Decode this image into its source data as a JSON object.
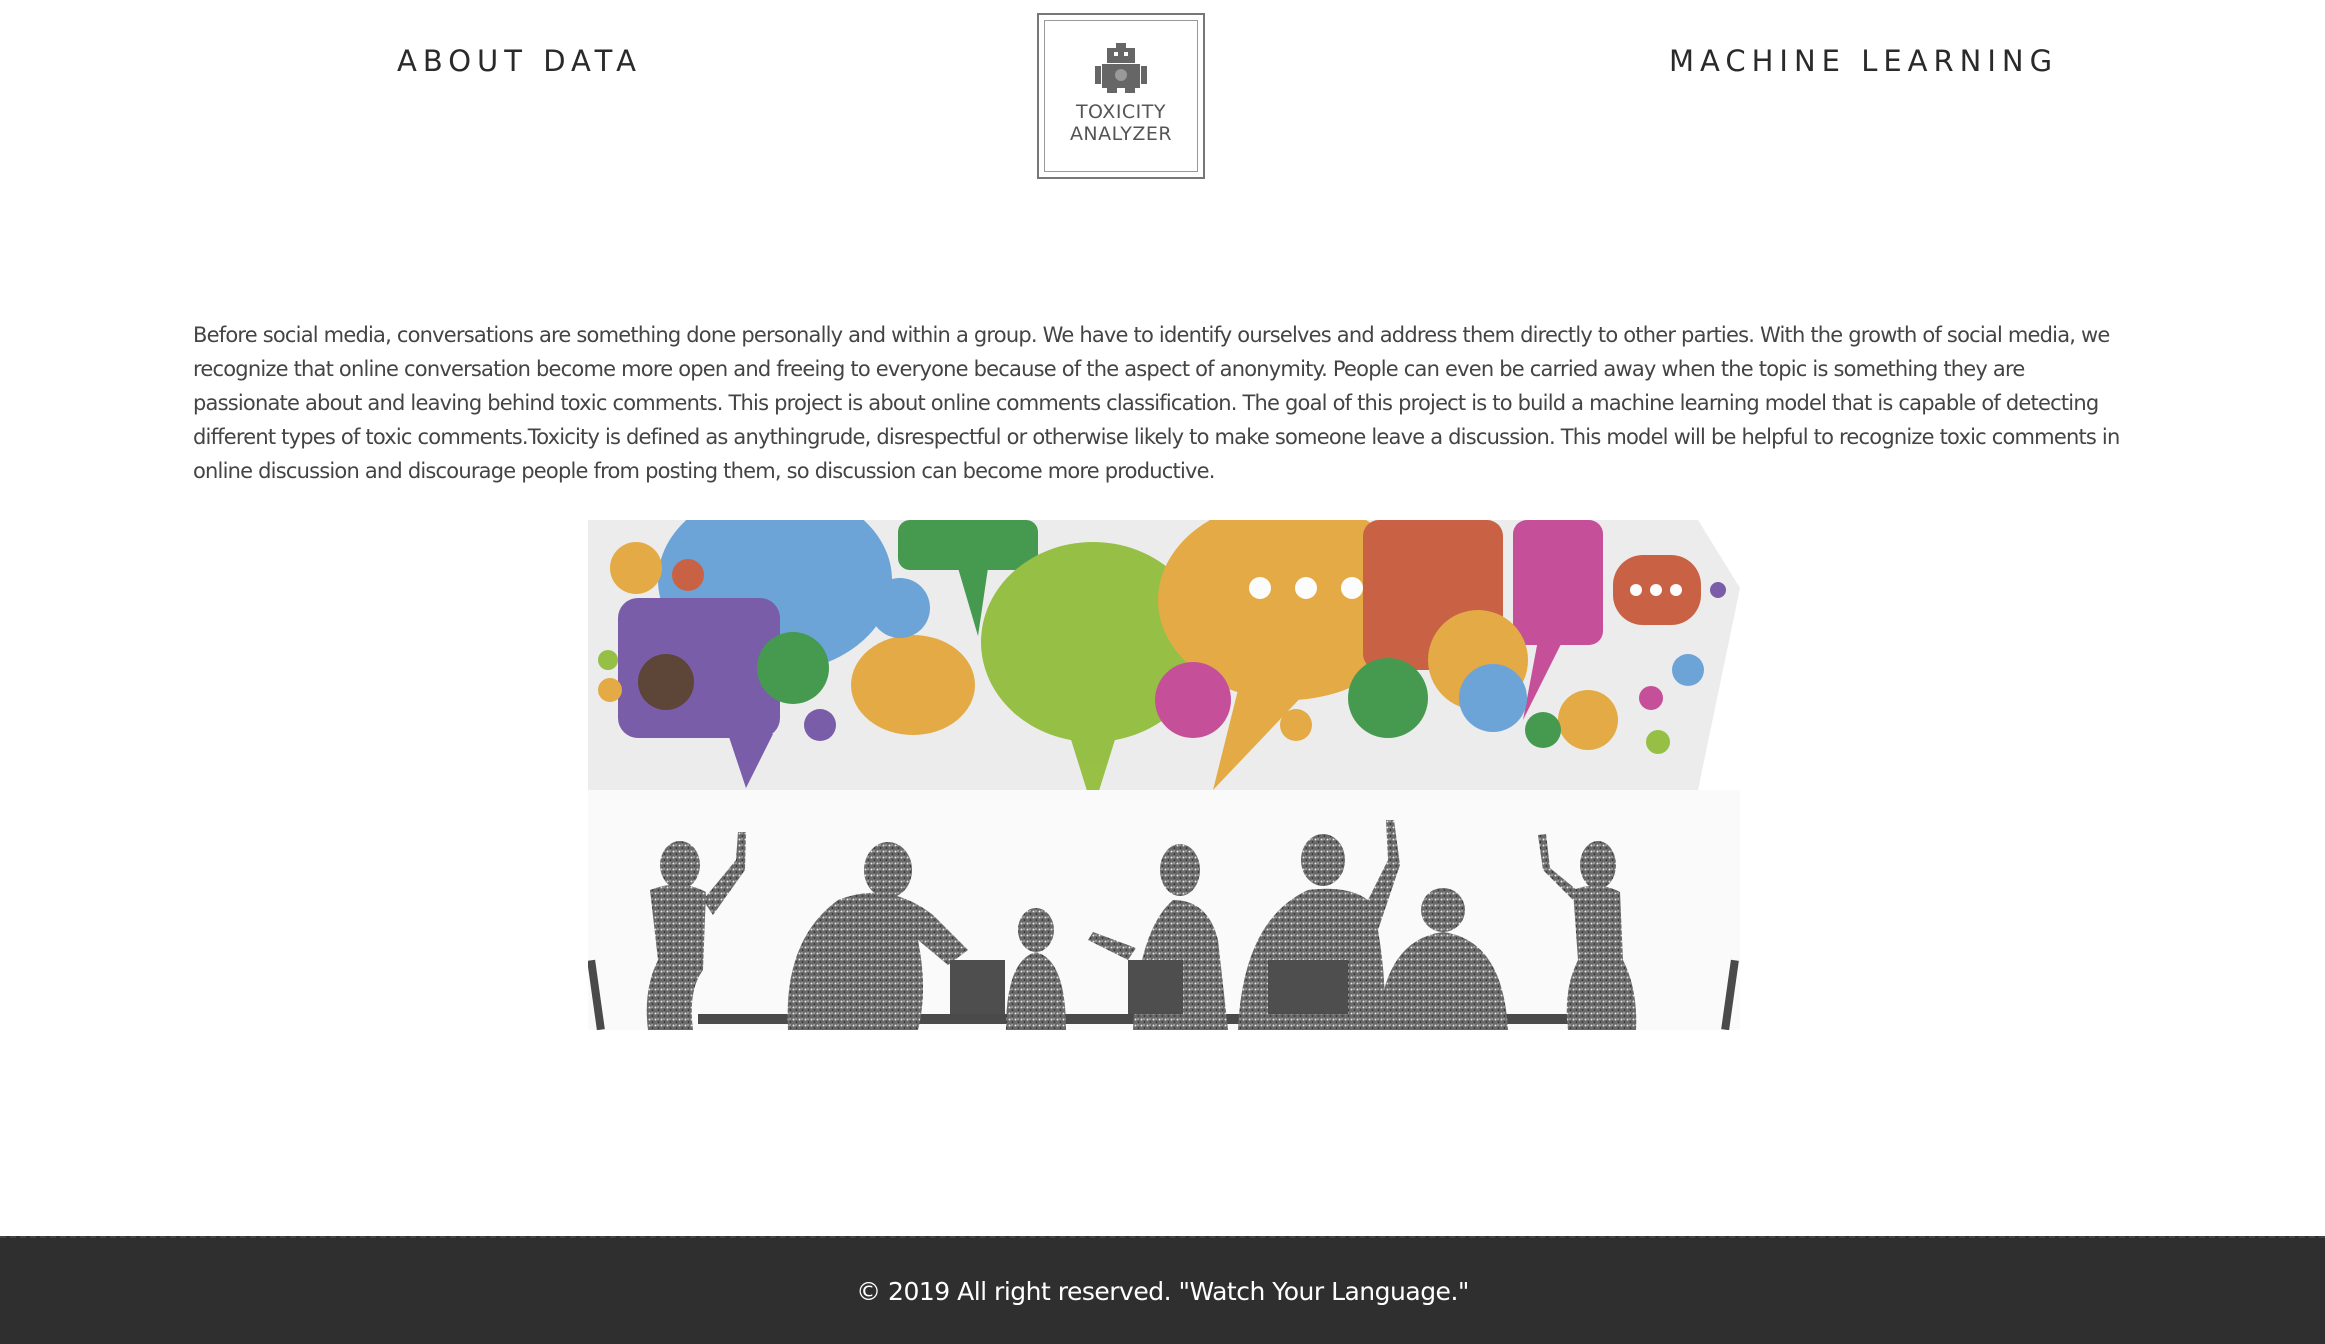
{
  "nav": {
    "left_label": "ABOUT DATA",
    "right_label": "MACHINE LEARNING"
  },
  "logo": {
    "line1": "TOXICITY",
    "line2": "ANALYZER",
    "icon": "robot-icon"
  },
  "intro": {
    "text": "Before social media, conversations are something done personally and within a group. We have to identify ourselves and address them directly to other parties. With the growth of social media, we recognize that online conversation become more open and freeing to everyone because of the aspect of anonymity. People can even be carried away when the topic is something they are passionate about and leaving behind toxic comments. This project is about online comments classification. The goal of this project is to build a machine learning model that is capable of detecting different types of toxic comments.Toxicity is defined as anythingrude, disrespectful or otherwise likely to make someone leave a discussion. This model will be helpful to recognize toxic comments in online discussion and discourage people from posting them, so discussion can become more productive."
  },
  "illustration": {
    "icon": "speech-bubbles-people-illustration"
  },
  "footer": {
    "text": "© 2019 All right reserved. \"Watch Your Language.\""
  },
  "colors": {
    "footer_bg": "#2f2f2f",
    "text": "#444444",
    "nav_text": "#2a2a2a"
  }
}
